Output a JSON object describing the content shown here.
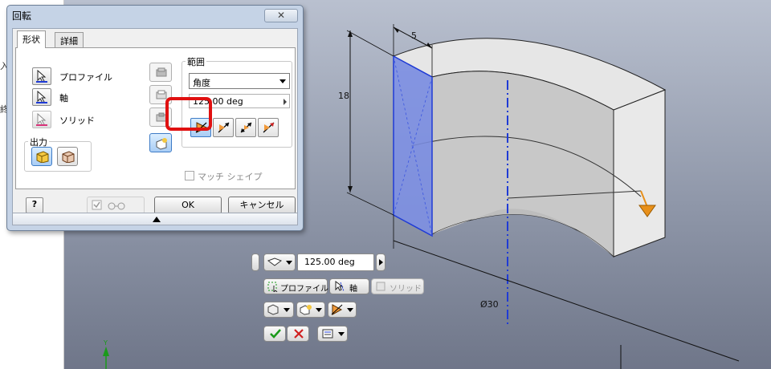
{
  "dialog": {
    "title": "回転",
    "tabs": [
      "形状",
      "詳細"
    ],
    "selectors": {
      "profile": "プロファイル",
      "axis": "軸",
      "solid": "ソリッド"
    },
    "output_group": "出力",
    "range": {
      "title": "範囲",
      "select_value": "角度",
      "angle_value": "125.00 deg"
    },
    "match_shape": "マッチ シェイプ",
    "ok": "OK",
    "cancel": "キャンセル",
    "help": "?"
  },
  "dimensions": {
    "width": "5",
    "height": "18",
    "diameter": "Ø30"
  },
  "mini_toolbar": {
    "angle_value": "125.00 deg",
    "profile": "プロファイル",
    "axis": "軸",
    "solid": "ソリッド"
  },
  "colors": {
    "highlight": "#e01010",
    "axis_line": "#1f3bd6",
    "profile_fill": "#7d8fe6",
    "direction_arrow": "#e8901a"
  },
  "left_strip": {
    "frag1": "入",
    "frag2": "終"
  }
}
